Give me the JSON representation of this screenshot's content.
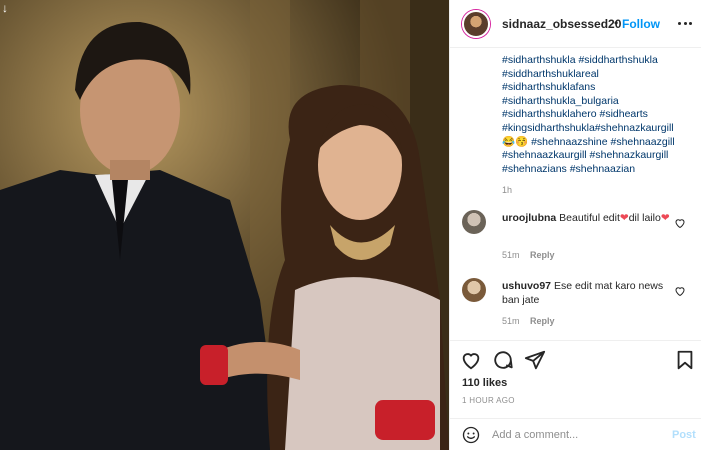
{
  "post": {
    "username": "sidnaaz_obsessed20",
    "separator": "•",
    "follow_label": "Follow",
    "caption": {
      "tags_top": [
        "#sidharthshukla #siddharthshukla",
        "#siddharthshuklareal",
        "#sidharthshuklafans",
        "#sidharthshukla_bulgaria",
        "#sidharthshuklahero  #sidhearts",
        "#kingsidharthshukla#shehnazkaurgill"
      ],
      "emoji_line_prefix": "😂😚",
      "emoji_line_tag": "#shehnaazshine #shehnaazgill",
      "tags_bottom": [
        "#shehnaazkaurgill #shehnazkaurgill",
        "#shehnazians #shehnaazian"
      ],
      "time": "1h"
    },
    "comments": [
      {
        "user": "uroojlubna",
        "text_before_heart": "Beautiful edit",
        "heart": "❤",
        "text_after_heart": "dil lailo",
        "heart_end": "❤",
        "time": "51m",
        "reply": "Reply"
      },
      {
        "user": "ushuvo97",
        "text": "Ese edit mat karo news ban jate",
        "time": "51m",
        "reply": "Reply"
      }
    ],
    "likes": "110 likes",
    "timestamp": "1 HOUR AGO",
    "add_comment_placeholder": "Add a comment...",
    "post_label": "Post"
  },
  "icons": {
    "arrow": "↓",
    "more": "more-options-icon",
    "heart": "heart-outline-icon",
    "comment": "comment-bubble-icon",
    "share": "paper-plane-icon",
    "save": "bookmark-icon",
    "emoji": "smiley-icon"
  },
  "colors": {
    "link": "#00376b",
    "follow": "#0095f6",
    "heart_red": "#ed4956",
    "muted": "#8e8e8e",
    "post_disabled": "#b2dffc"
  }
}
